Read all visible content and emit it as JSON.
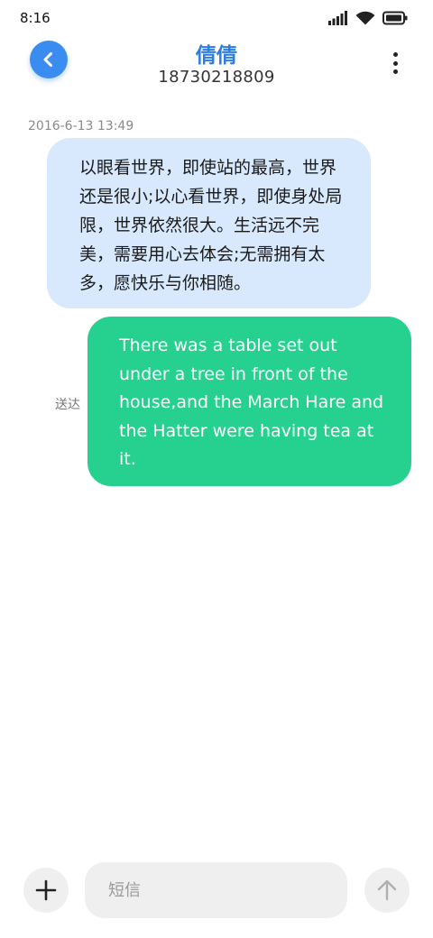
{
  "status_bar": {
    "time": "8:16",
    "icons": [
      "signal-icon",
      "wifi-icon",
      "battery-icon"
    ]
  },
  "header": {
    "back_icon": "chevron-left-icon",
    "contact_name": "倩倩",
    "contact_number": "18730218809",
    "more_icon": "more-vertical-icon",
    "accent_color": "#2d7de0"
  },
  "conversation": {
    "timestamp": "2016-6-13 13:49",
    "messages": [
      {
        "direction": "incoming",
        "text": "以眼看世界，即使站的最高，世界还是很小;以心看世界，即使身处局限，世界依然很大。生活远不完美，需要用心去体会;无需拥有太多，愿快乐与你相随。",
        "bubble_color": "#d8e9fd"
      },
      {
        "direction": "outgoing",
        "text": "There was a table set out under a tree in front of the house,and the March Hare and the Hatter were having tea at it.",
        "status": "送达",
        "bubble_color": "#26d18f"
      }
    ]
  },
  "composer": {
    "add_icon": "plus-icon",
    "placeholder": "短信",
    "value": "",
    "send_icon": "arrow-up-icon"
  }
}
